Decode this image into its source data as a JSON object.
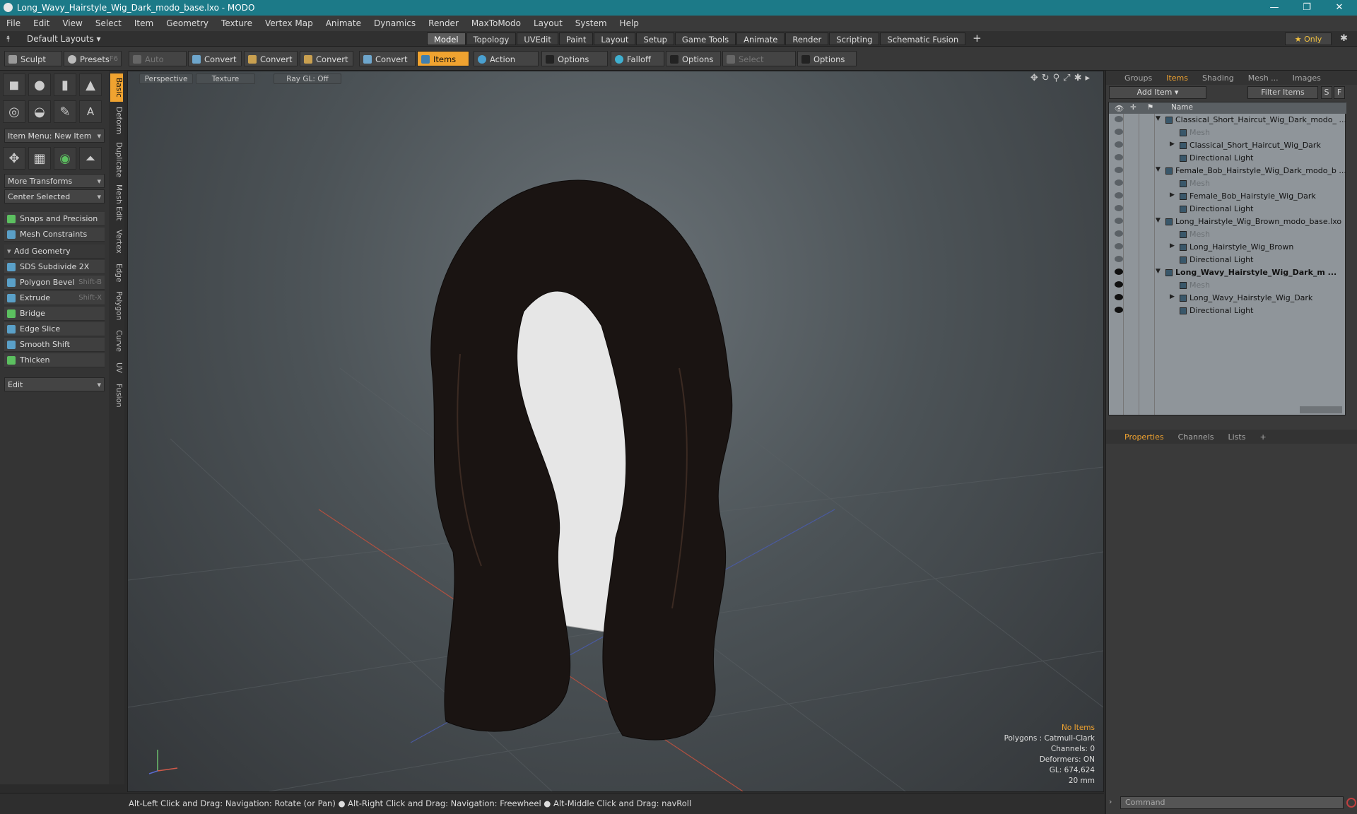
{
  "app": {
    "title": "Long_Wavy_Hairstyle_Wig_Dark_modo_base.lxo - MODO"
  },
  "menubar": [
    "File",
    "Edit",
    "View",
    "Select",
    "Item",
    "Geometry",
    "Texture",
    "Vertex Map",
    "Animate",
    "Dynamics",
    "Render",
    "MaxToModo",
    "Layout",
    "System",
    "Help"
  ],
  "layout_select": "Default Layouts ▾",
  "mode_tabs": [
    "Model",
    "Topology",
    "UVEdit",
    "Paint",
    "Layout",
    "Setup",
    "Game Tools",
    "Animate",
    "Render",
    "Scripting",
    "Schematic Fusion"
  ],
  "active_mode": "Model",
  "only_label": "★ Only",
  "toolbar": {
    "sculpt": "Sculpt",
    "presets": "Presets",
    "presets_shortcut": "F6",
    "auto_select": "Auto Select",
    "convert": "Convert",
    "items": "Items",
    "action_center": "Action Center",
    "options": "Options",
    "falloff": "Falloff",
    "select_through": "Select Through"
  },
  "left_panel": {
    "item_menu": "Item Menu: New Item",
    "more_transforms": "More Transforms",
    "center_selected": "Center Selected",
    "snaps": "Snaps and Precision",
    "mesh_constraints": "Mesh Constraints",
    "add_geometry": "Add Geometry",
    "tools": [
      {
        "label": "SDS Subdivide 2X",
        "shortcut": ""
      },
      {
        "label": "Polygon Bevel",
        "shortcut": "Shift-B"
      },
      {
        "label": "Extrude",
        "shortcut": "Shift-X"
      },
      {
        "label": "Bridge",
        "shortcut": ""
      },
      {
        "label": "Edge Slice",
        "shortcut": ""
      },
      {
        "label": "Smooth Shift",
        "shortcut": ""
      },
      {
        "label": "Thicken",
        "shortcut": ""
      }
    ],
    "edit": "Edit"
  },
  "side_tabs": [
    "Basic",
    "Deform",
    "Duplicate",
    "Mesh Edit",
    "Vertex",
    "Edge",
    "Polygon",
    "Curve",
    "UV",
    "Fusion"
  ],
  "viewport": {
    "view": "Perspective",
    "shading": "Texture",
    "raygl": "Ray GL: Off",
    "info": {
      "selection": "No Items",
      "polygons": "Polygons : Catmull-Clark",
      "channels": "Channels: 0",
      "deformers": "Deformers: ON",
      "gl": "GL: 674,624",
      "grid": "20 mm"
    }
  },
  "statusbar": "Alt-Left Click and Drag: Navigation: Rotate (or Pan) ● Alt-Right Click and Drag: Navigation: Freewheel ● Alt-Middle Click and Drag: navRoll",
  "right_panel": {
    "tabs": [
      "Groups",
      "Items",
      "Shading",
      "Mesh ...",
      "Images"
    ],
    "active_tab": "Items",
    "add_item": "Add Item",
    "filter_items": "Filter Items",
    "s_btn": "S",
    "f_btn": "F",
    "name_header": "Name",
    "tree": [
      {
        "label": "Classical_Short_Haircut_Wig_Dark_modo_ ...",
        "level": 0,
        "kind": "scene",
        "bold": false
      },
      {
        "label": "Mesh",
        "level": 1,
        "kind": "mesh",
        "grey": true
      },
      {
        "label": "Classical_Short_Haircut_Wig_Dark",
        "level": 1,
        "kind": "group"
      },
      {
        "label": "Directional Light",
        "level": 1,
        "kind": "light"
      },
      {
        "label": "Female_Bob_Hairstyle_Wig_Dark_modo_b ...",
        "level": 0,
        "kind": "scene"
      },
      {
        "label": "Mesh",
        "level": 1,
        "kind": "mesh",
        "grey": true
      },
      {
        "label": "Female_Bob_Hairstyle_Wig_Dark",
        "level": 1,
        "kind": "group"
      },
      {
        "label": "Directional Light",
        "level": 1,
        "kind": "light"
      },
      {
        "label": "Long_Hairstyle_Wig_Brown_modo_base.lxo",
        "level": 0,
        "kind": "scene"
      },
      {
        "label": "Mesh",
        "level": 1,
        "kind": "mesh",
        "grey": true
      },
      {
        "label": "Long_Hairstyle_Wig_Brown",
        "level": 1,
        "kind": "group"
      },
      {
        "label": "Directional Light",
        "level": 1,
        "kind": "light"
      },
      {
        "label": "Long_Wavy_Hairstyle_Wig_Dark_m ...",
        "level": 0,
        "kind": "scene",
        "bold": true
      },
      {
        "label": "Mesh",
        "level": 1,
        "kind": "mesh",
        "grey": true
      },
      {
        "label": "Long_Wavy_Hairstyle_Wig_Dark",
        "level": 1,
        "kind": "group"
      },
      {
        "label": "Directional Light",
        "level": 1,
        "kind": "light"
      }
    ],
    "props_tabs": [
      "Properties",
      "Channels",
      "Lists"
    ],
    "command_placeholder": "Command"
  }
}
